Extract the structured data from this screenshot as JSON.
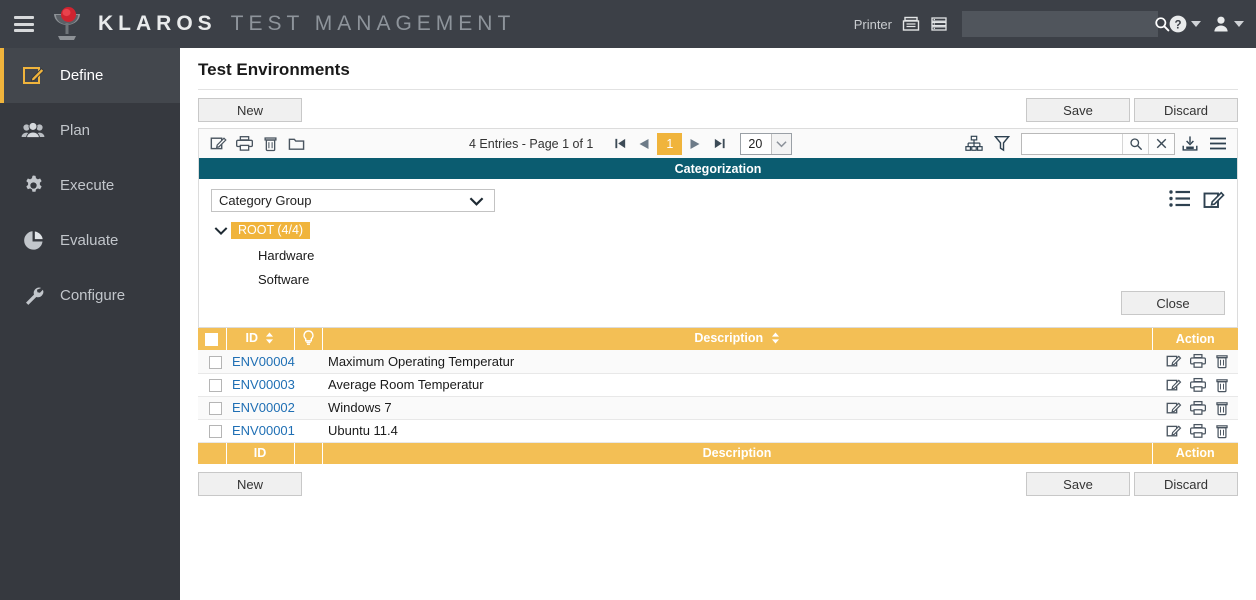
{
  "header": {
    "menu_icon": "hamburger-icon",
    "logo_icon": "klaros-logo-icon",
    "brand_primary": "KLAROS",
    "brand_secondary": "TEST MANAGEMENT",
    "printer_label": "Printer",
    "printer_icon": "printer-icon",
    "server_icon": "server-icon",
    "search_placeholder": "",
    "search_value": "",
    "search_icon": "search-icon",
    "help_icon": "help-circle-icon",
    "user_icon": "user-icon",
    "chevron_icon": "chevron-down-icon"
  },
  "sidebar": {
    "items": [
      {
        "label": "Define",
        "icon": "define-pencil-icon",
        "active": true
      },
      {
        "label": "Plan",
        "icon": "plan-users-icon",
        "active": false
      },
      {
        "label": "Execute",
        "icon": "execute-gear-icon",
        "active": false
      },
      {
        "label": "Evaluate",
        "icon": "evaluate-pie-icon",
        "active": false
      },
      {
        "label": "Configure",
        "icon": "configure-wrench-icon",
        "active": false
      }
    ]
  },
  "page": {
    "title": "Test Environments"
  },
  "top_actions": {
    "new_label": "New",
    "save_label": "Save",
    "discard_label": "Discard"
  },
  "bottom_actions": {
    "new_label": "New",
    "save_label": "Save",
    "discard_label": "Discard"
  },
  "grid_toolbar": {
    "edit_icon": "edit-icon",
    "print_icon": "print-icon",
    "delete_icon": "trash-icon",
    "folder_icon": "folder-icon",
    "entries_text": "4 Entries - Page 1 of 1",
    "first_icon": "first-page-icon",
    "prev_icon": "previous-page-icon",
    "current_page": "1",
    "next_icon": "next-page-icon",
    "last_icon": "last-page-icon",
    "page_size": "20",
    "page_size_chevron": "chevron-down-icon",
    "hierarchy_icon": "hierarchy-icon",
    "filter_icon": "filter-funnel-icon",
    "filter_value": "",
    "filter_placeholder": "",
    "filter_search_icon": "search-icon",
    "filter_clear_icon": "clear-x-icon",
    "export_icon": "export-download-icon",
    "menu_icon": "list-menu-icon"
  },
  "categorization": {
    "title": "Categorization",
    "group_select_value": "Category Group",
    "group_select_chevron": "chevron-down-icon",
    "tree_toggle_icon": "chevron-down-icon",
    "root_label": "ROOT (4/4)",
    "children": [
      "Hardware",
      "Software"
    ],
    "list_icon": "bullet-list-icon",
    "edit_icon": "edit-icon",
    "close_label": "Close"
  },
  "table": {
    "headers": {
      "check": "",
      "id": "ID",
      "bulb": "lightbulb-icon",
      "description": "Description",
      "action": "Action"
    },
    "footers": {
      "check": "",
      "id": "ID",
      "bulb": "",
      "description": "Description",
      "action": "Action"
    },
    "sort_icon": "sort-updown-icon",
    "row_icons": {
      "edit": "edit-icon",
      "print": "print-icon",
      "delete": "trash-icon"
    },
    "rows": [
      {
        "id": "ENV00004",
        "description": "Maximum Operating Temperatur"
      },
      {
        "id": "ENV00003",
        "description": "Average Room Temperatur"
      },
      {
        "id": "ENV00002",
        "description": "Windows 7"
      },
      {
        "id": "ENV00001",
        "description": "Ubuntu 11.4"
      }
    ]
  },
  "colors": {
    "brand_dark": "#3c4047",
    "sidebar": "#36393f",
    "accent_amber": "#f0b43c",
    "header_amber": "#f3bf55",
    "teal": "#0b5c70",
    "link_blue": "#1f6fb4"
  }
}
